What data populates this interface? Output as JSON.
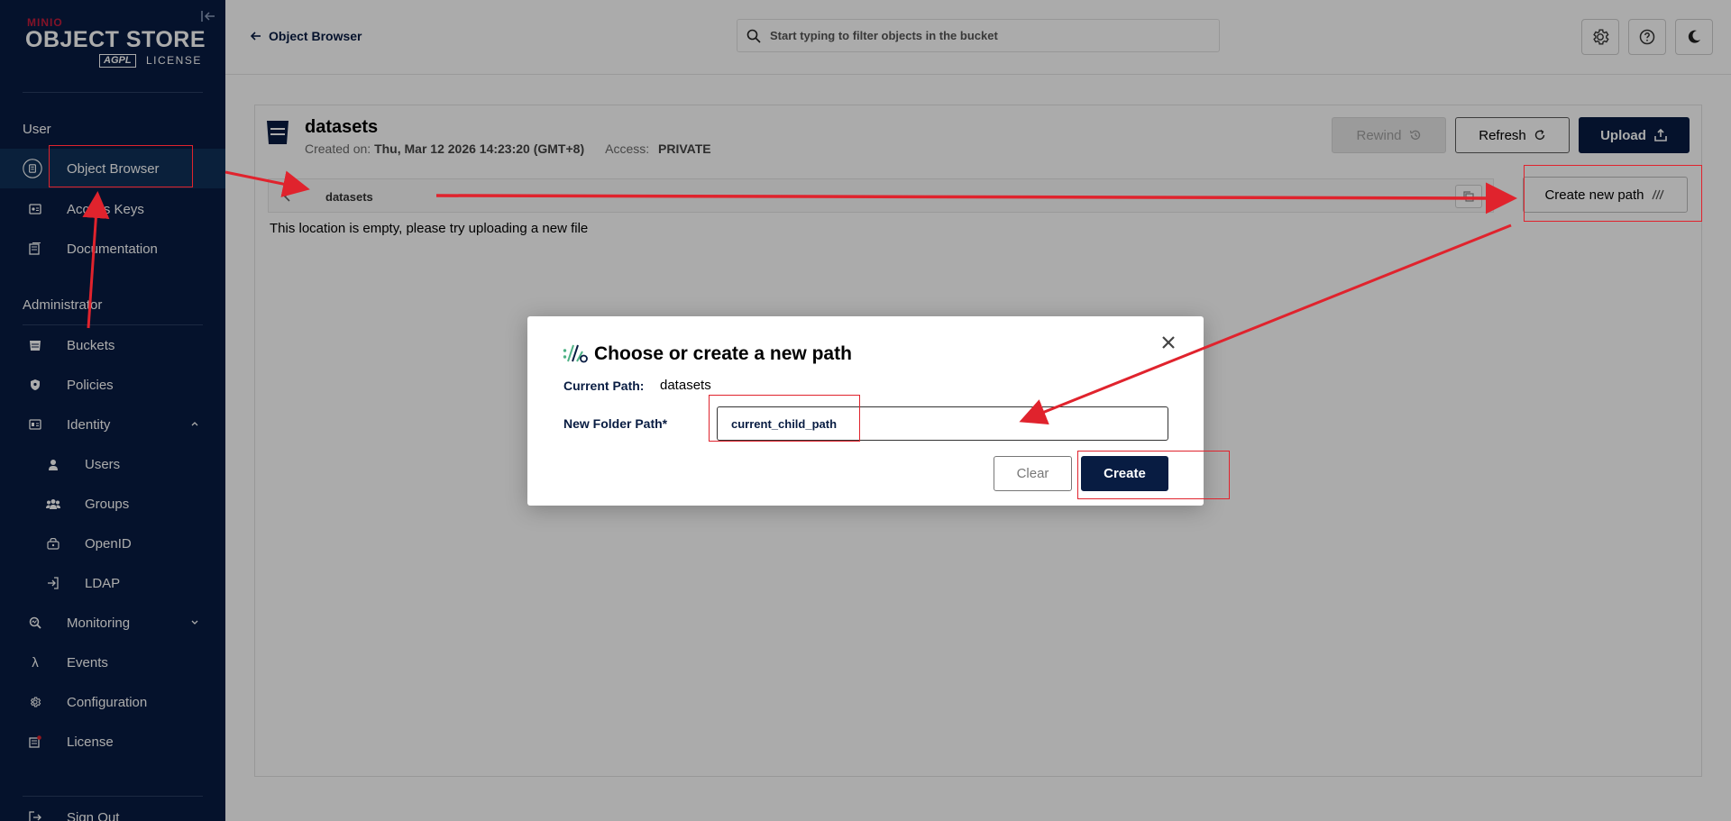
{
  "sidebar": {
    "brand": "MINIO",
    "title": "OBJECT STORE",
    "agpl": "AGPL",
    "license_label": "LICENSE",
    "sections": {
      "user": "User",
      "admin": "Administrator"
    },
    "items": {
      "object_browser": "Object Browser",
      "access_keys": "Access Keys",
      "documentation": "Documentation",
      "buckets": "Buckets",
      "policies": "Policies",
      "identity": "Identity",
      "users": "Users",
      "groups": "Groups",
      "openid": "OpenID",
      "ldap": "LDAP",
      "monitoring": "Monitoring",
      "events": "Events",
      "configuration": "Configuration",
      "license": "License",
      "sign_out": "Sign Out"
    }
  },
  "header": {
    "back_label": "Object Browser",
    "search_placeholder": "Start typing to filter objects in the bucket"
  },
  "bucket": {
    "name": "datasets",
    "created_label": "Created on:",
    "created_value": "Thu, Mar 12 2026 14:23:20 (GMT+8)",
    "access_label": "Access:",
    "access_value": "PRIVATE",
    "rewind_label": "Rewind",
    "refresh_label": "Refresh",
    "upload_label": "Upload",
    "breadcrumb": "datasets",
    "create_path_label": "Create new path",
    "empty_message": "This location is empty, please try uploading a new file"
  },
  "modal": {
    "title": "Choose or create a new path",
    "current_path_label": "Current Path:",
    "current_path_value": "datasets",
    "new_folder_label": "New Folder Path*",
    "new_folder_value": "current_child_path",
    "clear_label": "Clear",
    "create_label": "Create"
  },
  "colors": {
    "sidebar_bg": "#081c42",
    "primary": "#081c42",
    "annotation": "#e0232d",
    "brand_red": "#c51b3c",
    "accent_green": "#4fb286"
  }
}
